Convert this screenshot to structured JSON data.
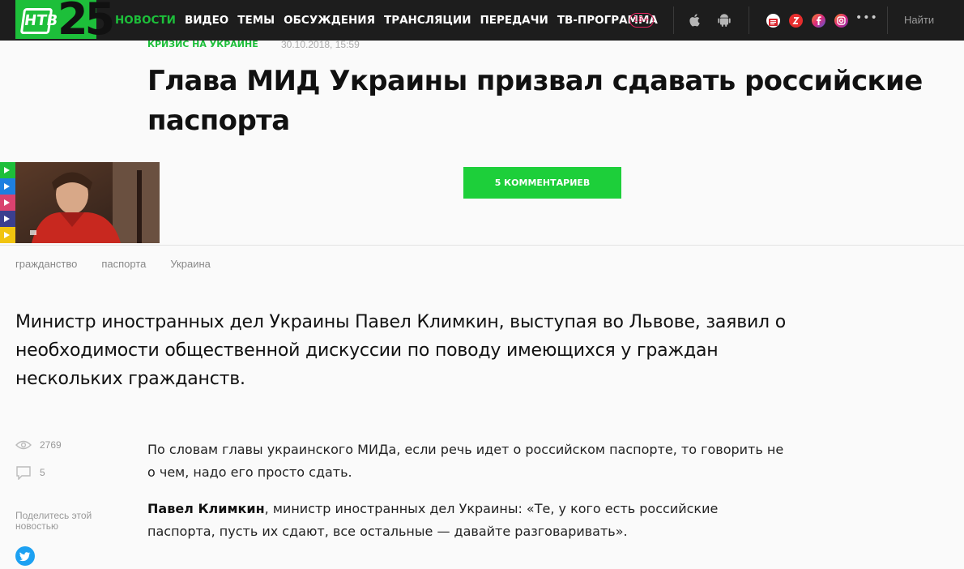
{
  "header": {
    "logo_text": "НТВ",
    "logo_number": "25",
    "nav": [
      {
        "label": "НОВОСТИ",
        "active": true
      },
      {
        "label": "ВИДЕО",
        "active": false
      },
      {
        "label": "ТЕМЫ",
        "active": false
      },
      {
        "label": "ОБСУЖДЕНИЯ",
        "active": false
      },
      {
        "label": "ТРАНСЛЯЦИИ",
        "active": false
      },
      {
        "label": "ПЕРЕДАЧИ",
        "active": false
      },
      {
        "label": "ТВ-ПРОГРАММА",
        "active": false
      }
    ],
    "age_badge": "18+",
    "search_label": "Найти",
    "icons": [
      "apple-icon",
      "android-icon",
      "news-icon",
      "zen-icon",
      "facebook-icon",
      "instagram-icon",
      "more-icon"
    ]
  },
  "article": {
    "rubric": "КРИЗИС НА УКРАИНЕ",
    "date": "30.10.2018, 15:59",
    "title": "Глава МИД Украины призвал сдавать российские паспорта",
    "comments_button": "5 КОММЕНТАРИЕВ",
    "tags": [
      "гражданство",
      "паспорта",
      "Украина"
    ],
    "lead": "Министр иностранных дел Украины Павел Климкин, выступая во Львове, заявил о необходимости общественной дискуссии по поводу имеющихся у граждан нескольких гражданств.",
    "paragraph1": "По словам главы украинского МИДа, если речь идет о российском паспорте, то говорить не о чем, надо его просто сдать.",
    "quote_author": "Павел Климкин",
    "quote_text": ", министр иностранных дел Украины: «Те, у кого есть российские паспорта, пусть их сдают, все остальные — давайте разговаривать»."
  },
  "sidebar": {
    "views": "2769",
    "comments": "5",
    "share_label": "Поделитесь этой новостью"
  },
  "colors": {
    "accent": "#1dbf3a",
    "topbar": "#1d1d1d",
    "age_badge": "#e0245e",
    "video_strip": [
      "#1dbf3a",
      "#1e7fe0",
      "#d9426f",
      "#3b3f8f",
      "#f1c40f"
    ]
  }
}
